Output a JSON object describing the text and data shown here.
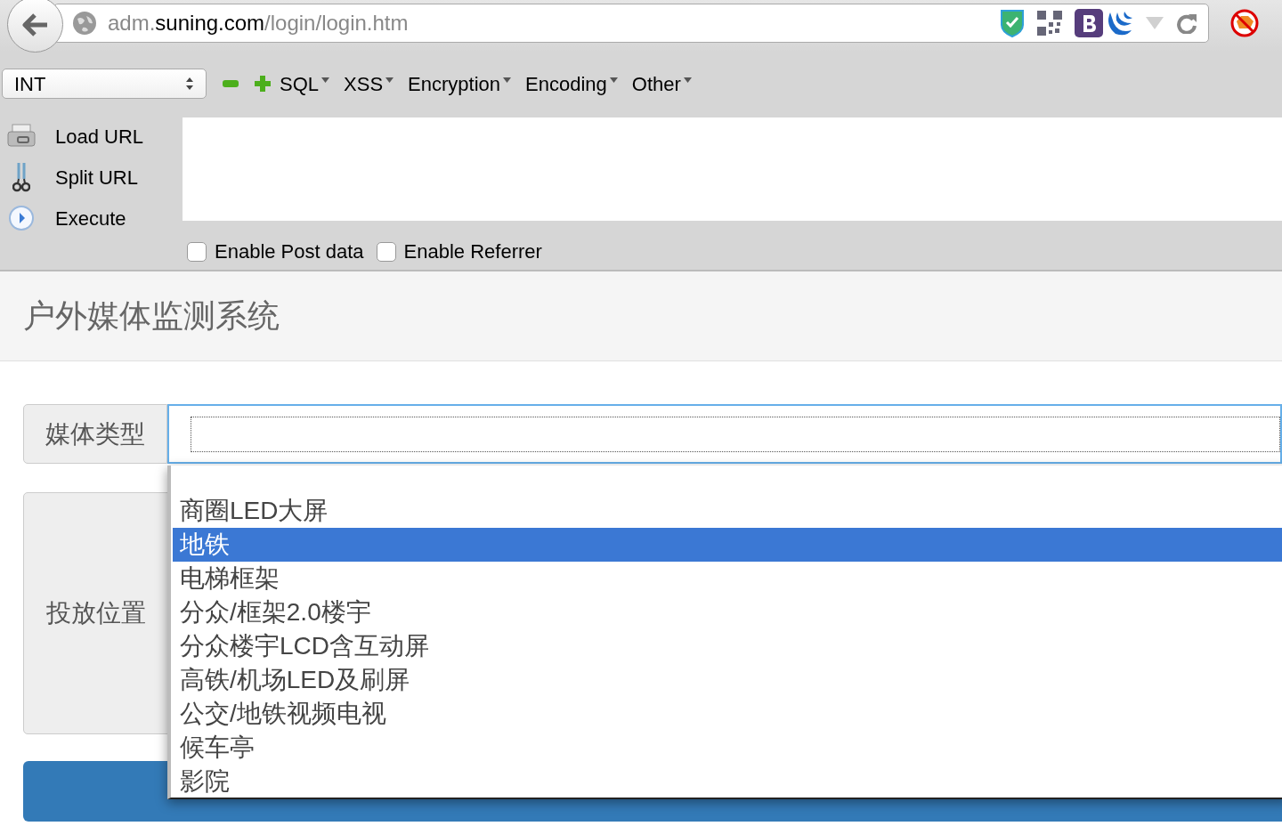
{
  "browser": {
    "url_parts": [
      {
        "text": "adm.",
        "emphasis": false
      },
      {
        "text": "suning.com",
        "emphasis": true
      },
      {
        "text": "/login/login.htm",
        "emphasis": false
      }
    ]
  },
  "hackbar": {
    "type_select": "INT",
    "menus": [
      "SQL",
      "XSS",
      "Encryption",
      "Encoding",
      "Other"
    ],
    "actions": [
      "Load URL",
      "Split URL",
      "Execute"
    ],
    "options": [
      {
        "label": "Enable Post data",
        "checked": false
      },
      {
        "label": "Enable Referrer",
        "checked": false
      }
    ]
  },
  "page": {
    "title": "户外媒体监测系统",
    "fields": [
      {
        "label": "媒体类型"
      },
      {
        "label": "投放位置"
      }
    ],
    "dropdown": [
      {
        "text": "商圈LED大屏",
        "selected": false
      },
      {
        "text": "地铁",
        "selected": true
      },
      {
        "text": "电梯框架",
        "selected": false
      },
      {
        "text": "分众/框架2.0楼宇",
        "selected": false
      },
      {
        "text": "分众楼宇LCD含互动屏",
        "selected": false
      },
      {
        "text": "高铁/机场LED及刷屏",
        "selected": false
      },
      {
        "text": "公交/地铁视频电视",
        "selected": false
      },
      {
        "text": "候车亭",
        "selected": false
      },
      {
        "text": "影院",
        "selected": false
      }
    ]
  }
}
